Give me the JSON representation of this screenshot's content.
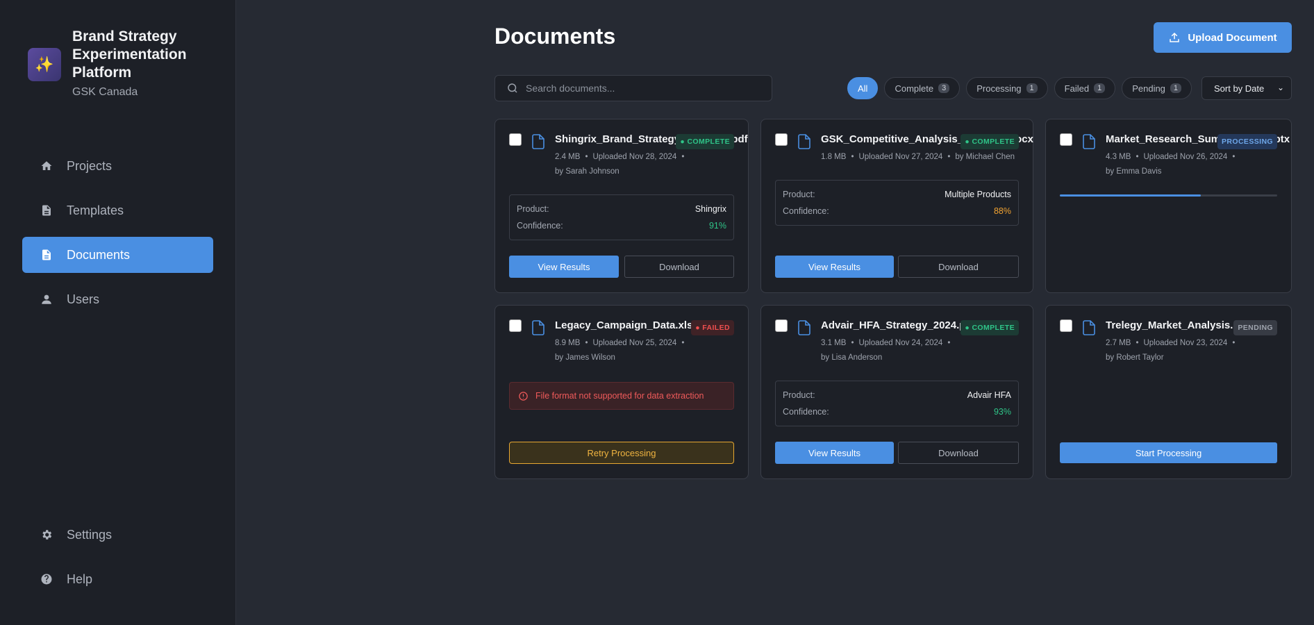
{
  "brand": {
    "title": "Brand Strategy Experimentation Platform",
    "subtitle": "GSK Canada",
    "logo_icon": "sparkles-icon"
  },
  "nav": {
    "items": [
      {
        "label": "Projects",
        "icon": "home-icon"
      },
      {
        "label": "Templates",
        "icon": "file-text-icon"
      },
      {
        "label": "Documents",
        "icon": "document-icon",
        "active": true
      },
      {
        "label": "Users",
        "icon": "user-icon"
      }
    ],
    "bottom": [
      {
        "label": "Settings",
        "icon": "gear-icon"
      },
      {
        "label": "Help",
        "icon": "help-circle-icon"
      }
    ]
  },
  "header": {
    "title": "Documents",
    "upload_label": "Upload Document"
  },
  "search": {
    "placeholder": "Search documents...",
    "value": ""
  },
  "filters": [
    {
      "label": "All",
      "active": true
    },
    {
      "label": "Complete",
      "count": "3"
    },
    {
      "label": "Processing",
      "count": "1"
    },
    {
      "label": "Failed",
      "count": "1"
    },
    {
      "label": "Pending",
      "count": "1"
    }
  ],
  "sort": {
    "label": "Sort by Date"
  },
  "documents": [
    {
      "name": "Shingrix_Brand_Strategy_Q4_2024.pdf",
      "size": "2.4 MB",
      "uploaded": "Uploaded Nov 28, 2024",
      "by": "by Sarah Johnson",
      "status": "COMPLETE",
      "product_label": "Product:",
      "product": "Shingrix",
      "confidence_label": "Confidence:",
      "confidence": "91%",
      "view_label": "View Results",
      "download_label": "Download"
    },
    {
      "name": "GSK_Competitive_Analysis_Nov2024.docx",
      "size": "1.8 MB",
      "uploaded": "Uploaded Nov 27, 2024",
      "by": "by Michael Chen",
      "status": "COMPLETE",
      "product_label": "Product:",
      "product": "Multiple Products",
      "confidence_label": "Confidence:",
      "confidence": "88%",
      "view_label": "View Results",
      "download_label": "Download"
    },
    {
      "name": "Market_Research_Summary_Q3.pptx",
      "size": "4.3 MB",
      "uploaded": "Uploaded Nov 26, 2024",
      "by": "by Emma Davis",
      "status": "PROCESSING",
      "progress": 0.65
    },
    {
      "name": "Legacy_Campaign_Data.xlsx",
      "size": "8.9 MB",
      "uploaded": "Uploaded Nov 25, 2024",
      "by": "by James Wilson",
      "status": "FAILED",
      "error": "File format not supported for data extraction",
      "retry_label": "Retry Processing"
    },
    {
      "name": "Advair_HFA_Strategy_2024.pdf",
      "size": "3.1 MB",
      "uploaded": "Uploaded Nov 24, 2024",
      "by": "by Lisa Anderson",
      "status": "COMPLETE",
      "product_label": "Product:",
      "product": "Advair HFA",
      "confidence_label": "Confidence:",
      "confidence": "93%",
      "view_label": "View Results",
      "download_label": "Download"
    },
    {
      "name": "Trelegy_Market_Analysis.pdf",
      "size": "2.7 MB",
      "uploaded": "Uploaded Nov 23, 2024",
      "by": "by Robert Taylor",
      "status": "PENDING",
      "start_label": "Start Processing"
    }
  ],
  "colors": {
    "accent": "#4a8fe2",
    "success": "#2fc488",
    "warning": "#f0a232",
    "danger": "#ef4f4f",
    "background": "#262a33",
    "sidebar": "#1d2027"
  }
}
